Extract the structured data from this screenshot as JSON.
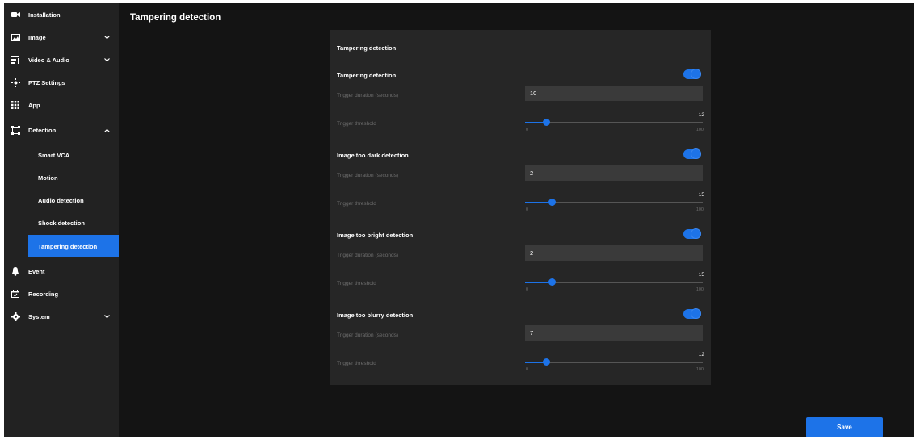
{
  "sidebar": {
    "items": [
      {
        "label": "Installation",
        "icon": "camera-icon"
      },
      {
        "label": "Image",
        "icon": "image-icon"
      },
      {
        "label": "Video & Audio",
        "icon": "video-audio-icon"
      },
      {
        "label": "PTZ Settings",
        "icon": "ptz-icon"
      },
      {
        "label": "App",
        "icon": "grid-icon"
      },
      {
        "label": "Detection",
        "icon": "detection-frame-icon"
      },
      {
        "label": "Event",
        "icon": "bell-icon"
      },
      {
        "label": "Recording",
        "icon": "calendar-icon"
      },
      {
        "label": "System",
        "icon": "gear-icon"
      }
    ],
    "detection_sub": [
      {
        "label": "Smart VCA"
      },
      {
        "label": "Motion"
      },
      {
        "label": "Audio detection"
      },
      {
        "label": "Shock detection"
      },
      {
        "label": "Tampering detection",
        "active": true
      }
    ]
  },
  "header": {
    "title": "Tampering detection"
  },
  "panel": {
    "title": "Tampering detection",
    "sections": [
      {
        "title": "Tampering detection",
        "enabled": true,
        "duration_label": "Trigger duration (seconds)",
        "duration": "10",
        "threshold_label": "Trigger threshold",
        "threshold": "12",
        "min": "0",
        "max": "100"
      },
      {
        "title": "Image too dark detection",
        "enabled": true,
        "duration_label": "Trigger duration (seconds)",
        "duration": "2",
        "threshold_label": "Trigger threshold",
        "threshold": "15",
        "min": "0",
        "max": "100"
      },
      {
        "title": "Image too bright detection",
        "enabled": true,
        "duration_label": "Trigger duration (seconds)",
        "duration": "2",
        "threshold_label": "Trigger threshold",
        "threshold": "15",
        "min": "0",
        "max": "100"
      },
      {
        "title": "Image too blurry detection",
        "enabled": true,
        "duration_label": "Trigger duration (seconds)",
        "duration": "7",
        "threshold_label": "Trigger threshold",
        "threshold": "12",
        "min": "0",
        "max": "100"
      }
    ]
  },
  "footer": {
    "save_label": "Save"
  },
  "colors": {
    "accent": "#1d73e8",
    "background": "#141414",
    "sidebar": "#222222",
    "panel": "#262626"
  }
}
